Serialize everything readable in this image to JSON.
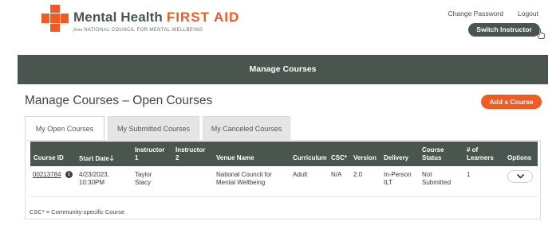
{
  "header": {
    "logo_title_part1": "Mental Health",
    "logo_title_part2": "FIRST AID",
    "logo_sub_from": "from",
    "logo_sub_org": "NATIONAL COUNCIL FOR MENTAL WELLBEING",
    "change_password": "Change Password",
    "logout": "Logout",
    "switch_instructor": "Switch Instructor"
  },
  "banner": {
    "title": "Manage Courses"
  },
  "page": {
    "title": "Manage Courses – Open Courses",
    "add_course": "Add a Course"
  },
  "tabs": [
    {
      "label": "My Open Courses",
      "active": true
    },
    {
      "label": "My Submitted Courses",
      "active": false
    },
    {
      "label": "My Canceled Courses",
      "active": false
    }
  ],
  "table": {
    "columns": {
      "course_id": "Course ID",
      "start_date": "Start Date",
      "start_date_sort": "🡓",
      "instructor1_a": "Instructor",
      "instructor1_b": "1",
      "instructor2_a": "Instructor",
      "instructor2_b": "2",
      "venue": "Venue Name",
      "curriculum": "Curriculum",
      "csc": "CSC*",
      "version": "Version",
      "delivery": "Delivery",
      "status_a": "Course",
      "status_b": "Status",
      "learners_a": "# of",
      "learners_b": "Learners",
      "options": "Options"
    },
    "rows": [
      {
        "course_id": "00213784",
        "start_date_a": "4/23/2023,",
        "start_date_b": "10:30PM",
        "instructor1_a": "Taylor",
        "instructor1_b": "Stacy",
        "instructor2": "",
        "venue_a": "National Council for",
        "venue_b": "Mental Wellbeing",
        "curriculum": "Adult",
        "csc": "N/A",
        "version": "2.0",
        "delivery_a": "In-Person",
        "delivery_b": "ILT",
        "status_a": "Not",
        "status_b": "Submitted",
        "learners": "1"
      }
    ],
    "footnote": "CSC* = Community-specific Course"
  },
  "icons": {
    "info": "info-icon",
    "options": "chevron-down-icon",
    "cursor": "hand-pointer-icon"
  },
  "colors": {
    "brand_orange": "#f05a23",
    "dark_slate": "#4b5550"
  }
}
